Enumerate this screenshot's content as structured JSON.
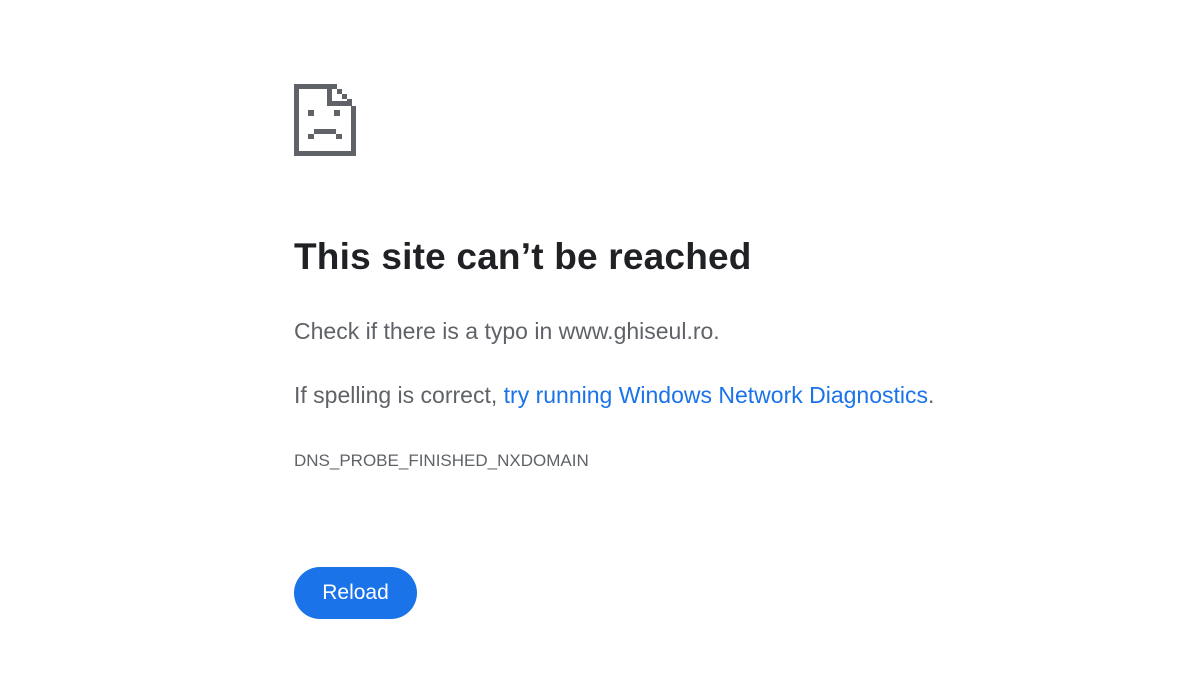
{
  "icon": "sad-file-icon",
  "title": "This site can’t be reached",
  "typo_message": "Check if there is a typo in www.ghiseul.ro.",
  "diagnostics": {
    "prefix": "If spelling is correct, ",
    "link_text": "try running Windows Network Diagnostics",
    "suffix": "."
  },
  "error_code": "DNS_PROBE_FINISHED_NXDOMAIN",
  "reload_button": {
    "label": "Reload"
  },
  "colors": {
    "title": "#202124",
    "body_text": "#5f6368",
    "link": "#1a73e8",
    "button_bg": "#1a73e8",
    "button_text": "#ffffff",
    "icon": "#5f6368"
  }
}
